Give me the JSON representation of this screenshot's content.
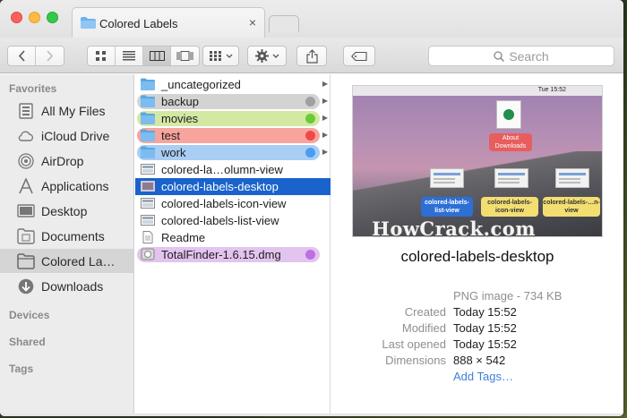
{
  "window": {
    "tab_title": "Colored Labels",
    "tab_close": "×"
  },
  "toolbar": {
    "back": "back",
    "forward": "forward",
    "search_placeholder": "Search"
  },
  "sidebar": {
    "sections": {
      "favorites": "Favorites",
      "devices": "Devices",
      "shared": "Shared",
      "tags": "Tags"
    },
    "items": [
      {
        "label": "All My Files",
        "icon": "all-files-icon"
      },
      {
        "label": "iCloud Drive",
        "icon": "cloud-icon"
      },
      {
        "label": "AirDrop",
        "icon": "airdrop-icon"
      },
      {
        "label": "Applications",
        "icon": "applications-icon"
      },
      {
        "label": "Desktop",
        "icon": "desktop-icon"
      },
      {
        "label": "Documents",
        "icon": "documents-icon"
      },
      {
        "label": "Colored La…",
        "icon": "folder-icon",
        "selected": true
      },
      {
        "label": "Downloads",
        "icon": "downloads-icon"
      }
    ]
  },
  "files": [
    {
      "name": "_uncategorized",
      "type": "folder",
      "arrow": true
    },
    {
      "name": "backup",
      "type": "folder",
      "arrow": true,
      "label_color": "#cfcfcf",
      "dot": "#a0a0a0"
    },
    {
      "name": "movies",
      "type": "folder",
      "arrow": true,
      "label_color": "#d3e9a3",
      "dot": "#6cc93a"
    },
    {
      "name": "test",
      "type": "folder",
      "arrow": true,
      "label_color": "#f7a49d",
      "dot": "#ef4a47"
    },
    {
      "name": "work",
      "type": "folder",
      "arrow": true,
      "label_color": "#a9cdf3",
      "dot": "#4a9df0"
    },
    {
      "name": "colored-la…olumn-view",
      "type": "image"
    },
    {
      "name": "colored-labels-desktop",
      "type": "image",
      "selected": true
    },
    {
      "name": "colored-labels-icon-view",
      "type": "image"
    },
    {
      "name": "colored-labels-list-view",
      "type": "image"
    },
    {
      "name": "Readme",
      "type": "doc"
    },
    {
      "name": "TotalFinder-1.6.15.dmg",
      "type": "dmg",
      "label_color": "#e2c4ef",
      "dot": "#c06ee0"
    }
  ],
  "preview": {
    "thumb": {
      "menubar_time": "Tue 15:52",
      "about_label": "About Downloads",
      "label_1": "colored-labels-list-view",
      "label_2": "colored-labels-icon-view",
      "label_3": "colored-labels-…n-view"
    },
    "watermark": "HowCrack.com",
    "title": "colored-labels-desktop",
    "kind": "PNG image - 734 KB",
    "info": [
      {
        "key": "Created",
        "value": "Today 15:52"
      },
      {
        "key": "Modified",
        "value": "Today 15:52"
      },
      {
        "key": "Last opened",
        "value": "Today 15:52"
      },
      {
        "key": "Dimensions",
        "value": "888 × 542"
      }
    ],
    "add_tags": "Add Tags…"
  },
  "colors": {
    "selection": "#1a63cc",
    "folder_blue": "#5ba6e6"
  }
}
